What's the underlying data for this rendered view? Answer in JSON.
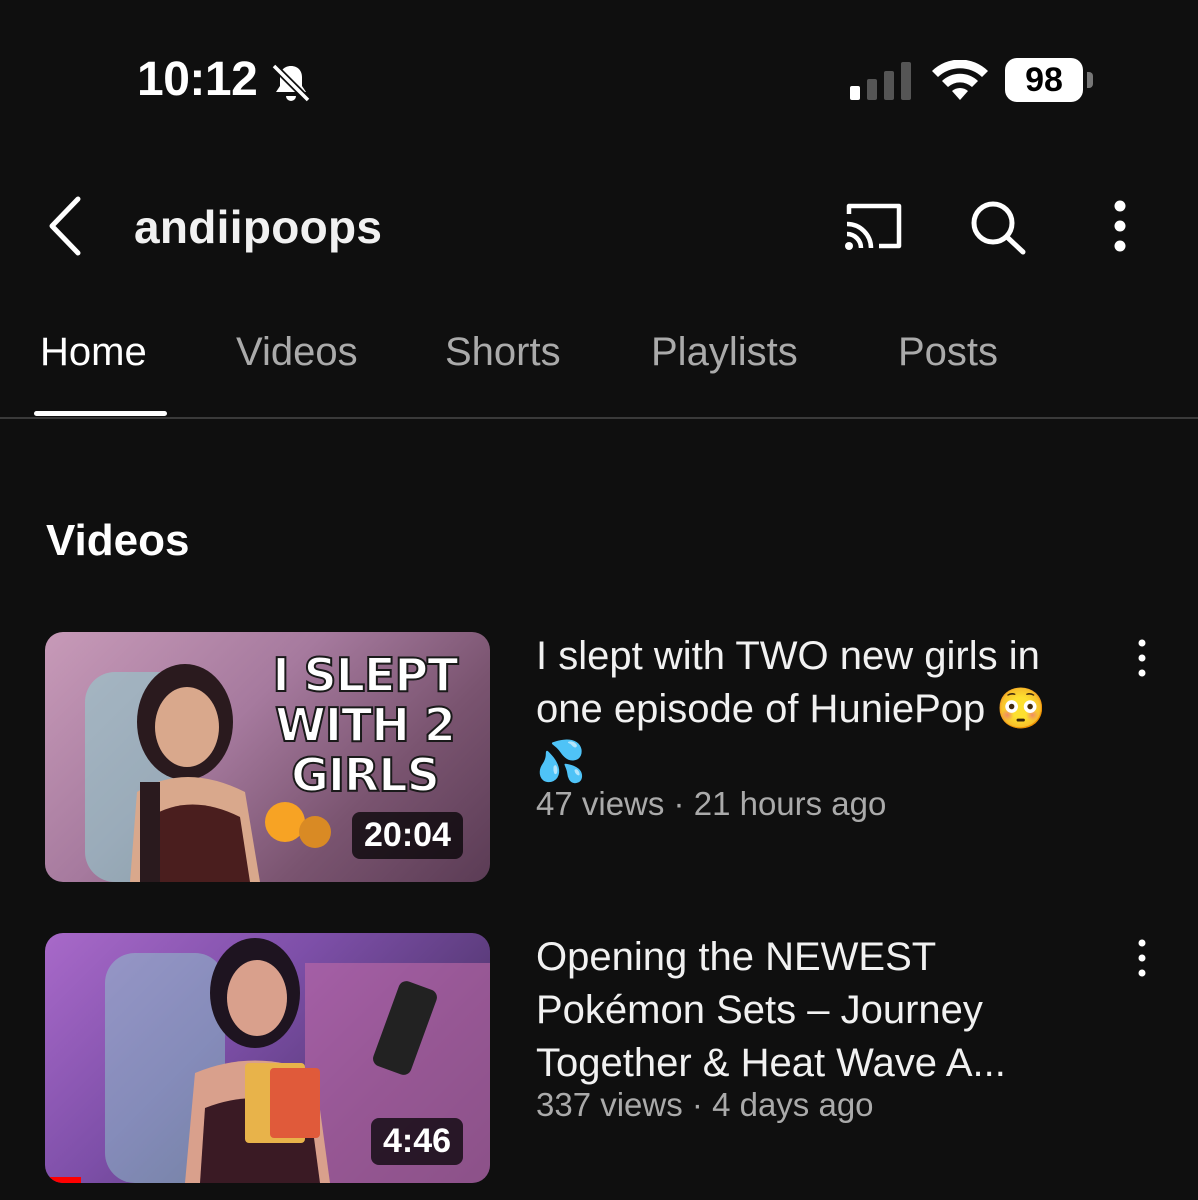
{
  "status_bar": {
    "time": "10:12",
    "battery": "98",
    "icons": [
      "bell-muted-icon",
      "cellular-signal-icon",
      "wifi-icon",
      "battery-icon"
    ]
  },
  "header": {
    "channel_name": "andiipoops",
    "icons": [
      "back-icon",
      "cast-icon",
      "search-icon",
      "more-vertical-icon"
    ]
  },
  "tabs": [
    {
      "label": "Home",
      "active": true
    },
    {
      "label": "Videos",
      "active": false
    },
    {
      "label": "Shorts",
      "active": false
    },
    {
      "label": "Playlists",
      "active": false
    },
    {
      "label": "Posts",
      "active": false
    }
  ],
  "section": {
    "title": "Videos"
  },
  "videos": [
    {
      "title": "I slept with TWO new girls in one episode of HuniePop 😳 💦",
      "views": "47 views",
      "age": "21 hours ago",
      "separator": " · ",
      "duration": "20:04",
      "thumbnail_text": "I SLEPT WITH 2 GIRLS",
      "thumbnail_emoji": "🔥🤐"
    },
    {
      "title": "Opening the NEWEST Pokémon Sets – Journey Together & Heat Wave A...",
      "views": "337 views",
      "age": "4 days ago",
      "separator": " · ",
      "duration": "4:46",
      "watched_fraction": 0.08
    }
  ],
  "colors": {
    "background": "#0f0f0f",
    "text_primary": "#f1f1f1",
    "text_secondary": "#aaaaaa",
    "progress": "#ff0000"
  }
}
